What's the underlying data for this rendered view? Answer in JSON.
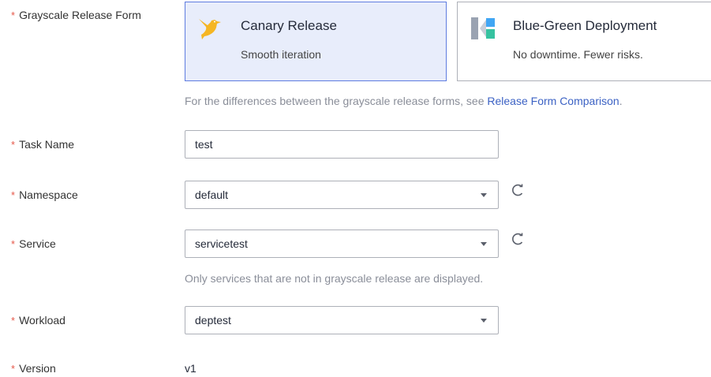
{
  "form": {
    "release_form_label": "Grayscale Release Form",
    "task_name_label": "Task Name",
    "namespace_label": "Namespace",
    "service_label": "Service",
    "workload_label": "Workload",
    "version_label": "Version",
    "required_mark": "*"
  },
  "release_forms": [
    {
      "title": "Canary Release",
      "desc": "Smooth iteration",
      "selected": true,
      "icon": "canary-bird-icon"
    },
    {
      "title": "Blue-Green Deployment",
      "desc": "No downtime. Fewer risks.",
      "selected": false,
      "icon": "blue-green-icon"
    }
  ],
  "release_form_hint": {
    "text": "For the differences between the grayscale release forms, see ",
    "link": "Release Form Comparison",
    "suffix": "."
  },
  "task_name": {
    "value": "test"
  },
  "namespace": {
    "value": "default"
  },
  "service": {
    "value": "servicetest",
    "hint": "Only services that are not in grayscale release are displayed."
  },
  "workload": {
    "value": "deptest"
  },
  "version": {
    "value": "v1"
  },
  "colors": {
    "accent": "#5e7ce0",
    "selected_bg": "#e8edfb",
    "required": "#e6584a",
    "link": "#3c62c4",
    "canary_yellow": "#f5b623",
    "blue_green_blue": "#41a6f4",
    "blue_green_green": "#36c2a0"
  }
}
